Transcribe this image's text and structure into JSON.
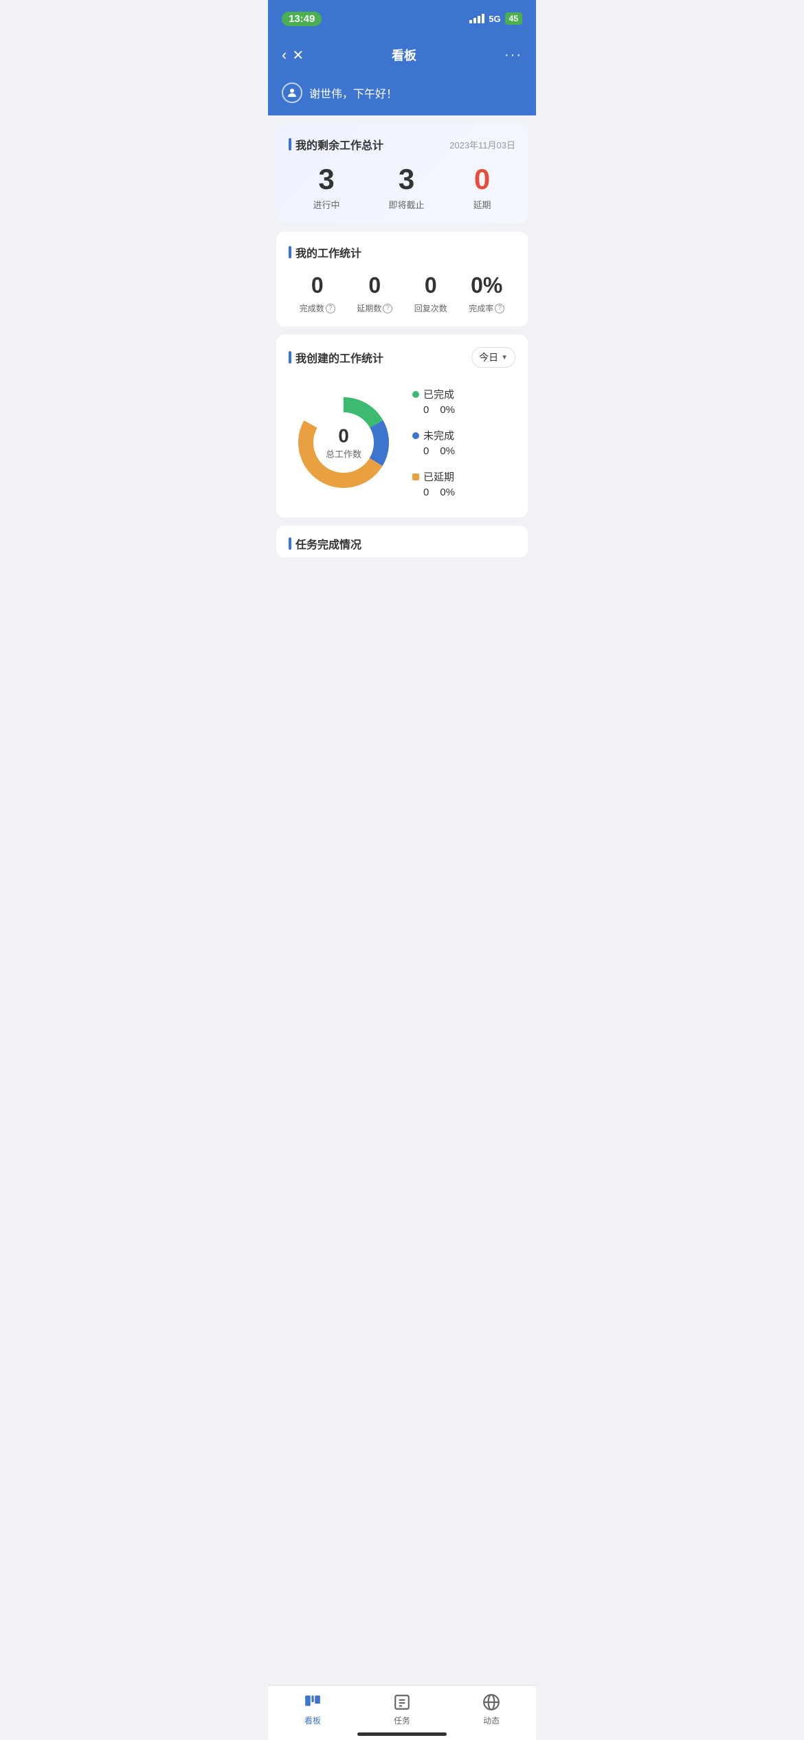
{
  "statusBar": {
    "time": "13:49",
    "network": "5G",
    "battery": "45"
  },
  "header": {
    "title": "看板",
    "backLabel": "‹",
    "closeLabel": "✕",
    "moreLabel": "···"
  },
  "greeting": {
    "username": "谢世伟，下午好！"
  },
  "summaryCard": {
    "title": "我的剩余工作总计",
    "date": "2023年11月03日",
    "inProgress": "3",
    "inProgressLabel": "进行中",
    "upcoming": "3",
    "upcomingLabel": "即将截止",
    "overdue": "0",
    "overdueLabel": "延期"
  },
  "workStatsCard": {
    "title": "我的工作统计",
    "completed": "0",
    "completedLabel": "完成数",
    "overdue": "0",
    "overdueLabel": "延期数",
    "replies": "0",
    "repliesLabel": "回复次数",
    "completionRate": "0%",
    "completionRateLabel": "完成率"
  },
  "createdStatsCard": {
    "title": "我创建的工作统计",
    "filterLabel": "今日",
    "donutCenter": "0",
    "donutLabel": "总工作数",
    "legend": [
      {
        "name": "已完成",
        "color": "#3dba72",
        "count": "0",
        "percent": "0%"
      },
      {
        "name": "未完成",
        "color": "#3d74d0",
        "count": "0",
        "percent": "0%"
      },
      {
        "name": "已延期",
        "color": "#e8a040",
        "count": "0",
        "percent": "0%"
      }
    ],
    "donutColors": {
      "completed": "#3dba72",
      "incomplete": "#3d74d0",
      "overdue": "#e8a040"
    }
  },
  "taskCompletionSection": {
    "title": "任务完成情况"
  },
  "bottomNav": {
    "items": [
      {
        "label": "看板",
        "active": true
      },
      {
        "label": "任务",
        "active": false
      },
      {
        "label": "动态",
        "active": false
      }
    ]
  }
}
